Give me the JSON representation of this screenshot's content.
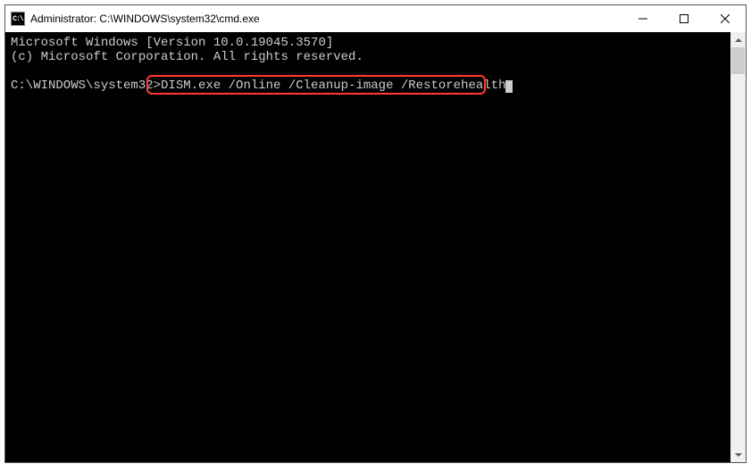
{
  "titlebar": {
    "icon_text": "C:\\",
    "title": "Administrator: C:\\WINDOWS\\system32\\cmd.exe"
  },
  "console": {
    "line1": "Microsoft Windows [Version 10.0.19045.3570]",
    "line2": "(c) Microsoft Corporation. All rights reserved.",
    "blank": "",
    "prompt": "C:\\WINDOWS\\system32>",
    "command": "DISM.exe /Online /Cleanup-image /Restorehealth"
  }
}
